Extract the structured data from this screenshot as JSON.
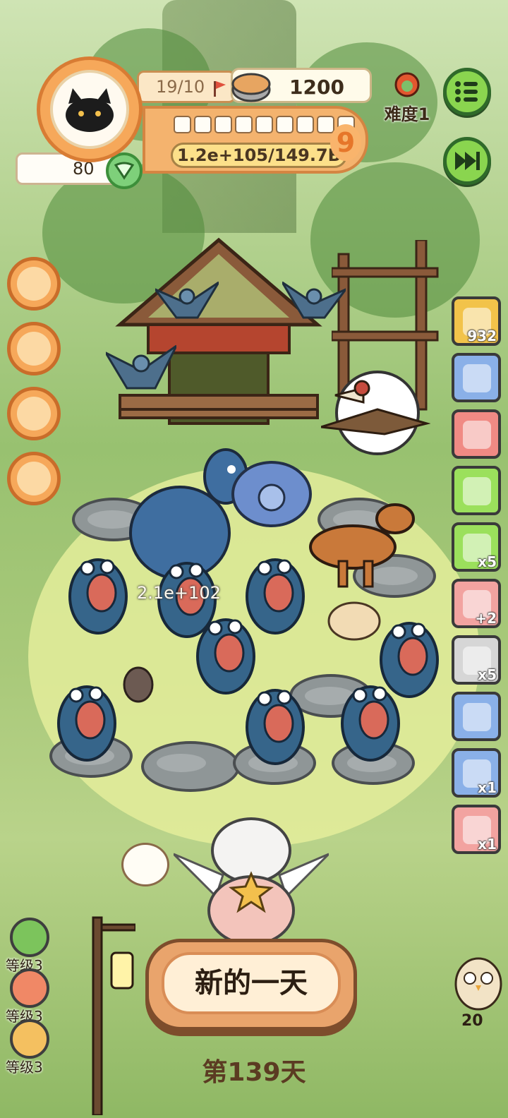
{
  "player": {
    "level_progress": "19/10",
    "coins": "1200",
    "experience": "1.2e+105/149.7B",
    "rank": "9",
    "hearts": "80",
    "progress_boxes": 9
  },
  "difficulty": {
    "label": "难度1"
  },
  "buttons": {
    "menu": "menu-icon",
    "fast_forward": "fast-forward-icon",
    "new_day": "新的一天"
  },
  "left_menu": [
    {
      "icon": "cat-face-icon"
    },
    {
      "icon": "scratch-post-icon"
    },
    {
      "icon": "box-icon"
    },
    {
      "icon": "medkit-icon"
    }
  ],
  "side_items": [
    {
      "icon": "egg-nest-icon",
      "count": "932",
      "color": "#f2c34a"
    },
    {
      "icon": "camera-icon",
      "count": "",
      "color": "#8ab0e8"
    },
    {
      "icon": "bomb-icon",
      "count": "",
      "color": "#f08a84"
    },
    {
      "icon": "card-icon",
      "count": "",
      "color": "#9be05c"
    },
    {
      "icon": "fossil-icon",
      "count": "x5",
      "color": "#9be05c"
    },
    {
      "icon": "paw-icon",
      "count": "+2",
      "color": "#f2a3a0"
    },
    {
      "icon": "engine-icon",
      "count": "x5",
      "color": "#d6d6d6"
    },
    {
      "icon": "jar-icon",
      "count": "",
      "color": "#8ab0e8"
    },
    {
      "icon": "tin-can-icon",
      "count": "x1",
      "color": "#8ab0e8"
    },
    {
      "icon": "lock-icon",
      "count": "x1",
      "color": "#f2a3a0"
    }
  ],
  "boosts": [
    {
      "label": "等级3",
      "color": "#7cc45c"
    },
    {
      "label": "等级3",
      "color": "#f08866"
    },
    {
      "label": "等级3",
      "color": "#f4c060"
    }
  ],
  "field": {
    "damage": "2.1e+102"
  },
  "day": "第139天",
  "owl_count": "20"
}
